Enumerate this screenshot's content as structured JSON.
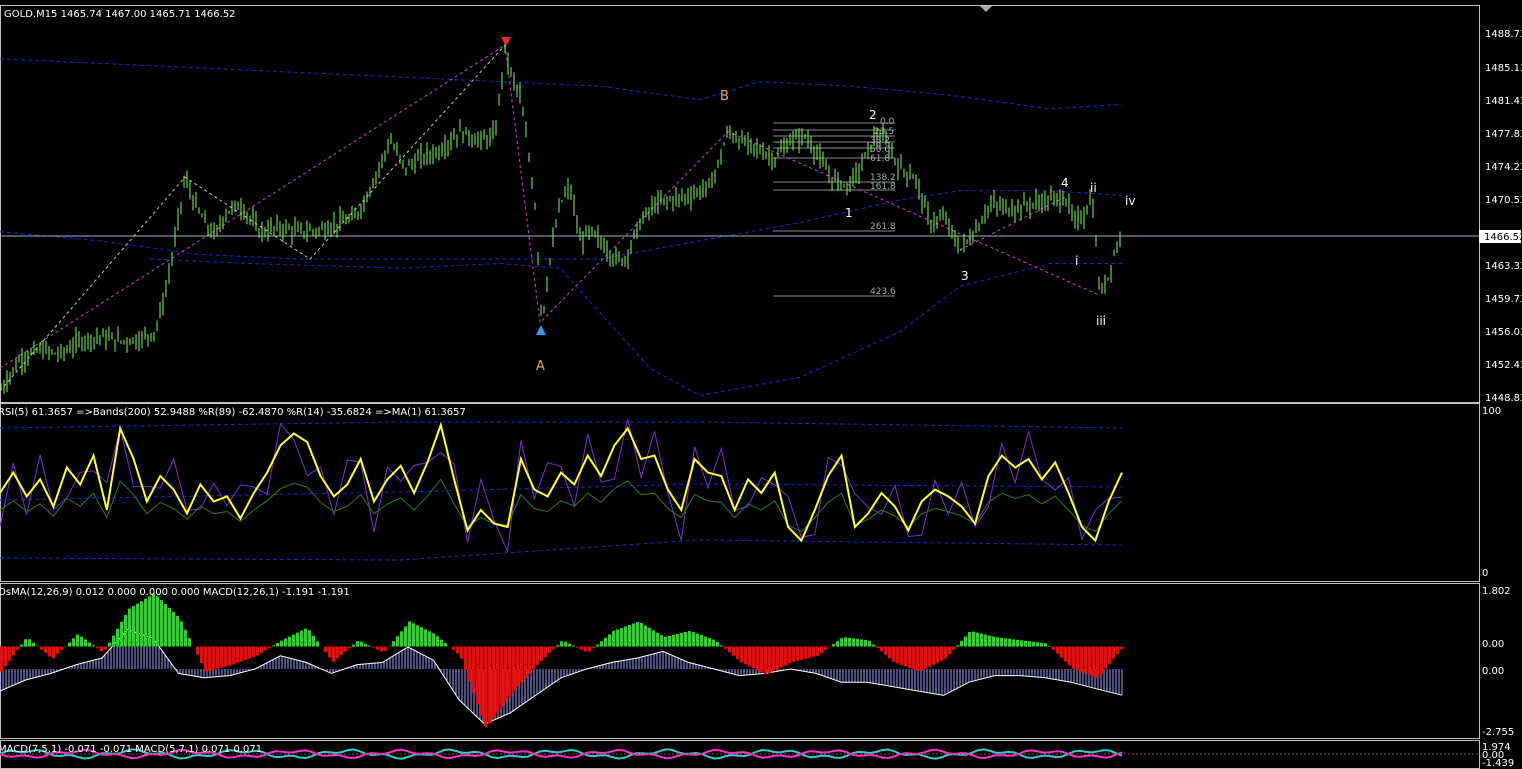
{
  "window": {
    "symbol_header": "GOLD,M15  1465.74 1467.00 1465.71 1466.52"
  },
  "colors": {
    "background": "#000000",
    "candle": "#7CFC5A",
    "band": "#2222cc",
    "rsi": "#ffff33",
    "rsi_r89": "#7a2fd0",
    "rsi_r14": "#2f7a1f",
    "hist_up": "#33cc33",
    "hist_down": "#dd1111",
    "macd_bars": "#9a9aff",
    "macd_line": "#ffffff",
    "small_macd_main": "#33cccc",
    "small_macd_signal": "#ff33cc",
    "border": "#c0c0c0"
  },
  "price_panel": {
    "current_price_label": "1466.52",
    "y_ticks": [
      "1488.73",
      "1485.13",
      "1481.43",
      "1477.83",
      "1474.23",
      "1470.53",
      "1466.52",
      "1463.33",
      "1459.73",
      "1456.03",
      "1452.43",
      "1448.83"
    ]
  },
  "wave_labels": {
    "A": "A",
    "B": "B",
    "w1": "1",
    "w2": "2",
    "w3": "3",
    "w4": "4",
    "wi": "i",
    "wii": "ii",
    "wiii": "iii",
    "wiv": "iv"
  },
  "fib_levels": [
    "0.0",
    "23.5",
    "38.2",
    "50.0",
    "61.8",
    "138.2",
    "161.8",
    "261.8",
    "423.6"
  ],
  "rsi_panel": {
    "header": "RSI(5) 61.3657  =>Bands(200) 52.9488  %R(89) -62.4870  %R(14) -35.6824  =>MA(1) 61.3657",
    "y_top": "100",
    "y_bottom": "0"
  },
  "osma_panel": {
    "header": "OsMA(12,26,9) 0.012 0.000 0.000 0.000  MACD(12,26,1) -1.191 -1.191",
    "y_top": "1.802",
    "y_mid": "0.00",
    "y_mid2": "0.00",
    "y_bottom": "-2.755"
  },
  "small_macd_panel": {
    "header": "MACD(7,5,1) -0.071 -0.071  MACD(5,7,1) 0.071 0.071",
    "y_top": "1.974",
    "y_mid": "0.00",
    "y_bottom": "-1.439"
  },
  "chart_data": {
    "type": "line",
    "title": "GOLD,M15",
    "price_path": [
      [
        0,
        1449.5
      ],
      [
        20,
        1453
      ],
      [
        40,
        1454
      ],
      [
        60,
        1453.5
      ],
      [
        80,
        1455
      ],
      [
        100,
        1455.5
      ],
      [
        120,
        1455
      ],
      [
        140,
        1455.2
      ],
      [
        155,
        1456
      ],
      [
        165,
        1460
      ],
      [
        175,
        1466
      ],
      [
        185,
        1473
      ],
      [
        195,
        1470
      ],
      [
        205,
        1468
      ],
      [
        215,
        1466.5
      ],
      [
        225,
        1469
      ],
      [
        240,
        1470
      ],
      [
        260,
        1467
      ],
      [
        280,
        1467.5
      ],
      [
        300,
        1467
      ],
      [
        320,
        1467.2
      ],
      [
        340,
        1468
      ],
      [
        355,
        1468.5
      ],
      [
        365,
        1470.5
      ],
      [
        375,
        1473
      ],
      [
        390,
        1477
      ],
      [
        405,
        1474
      ],
      [
        420,
        1475
      ],
      [
        440,
        1476
      ],
      [
        460,
        1478
      ],
      [
        480,
        1477
      ],
      [
        495,
        1477.5
      ],
      [
        505,
        1487
      ],
      [
        512,
        1484
      ],
      [
        520,
        1482
      ],
      [
        528,
        1476
      ],
      [
        535,
        1470
      ],
      [
        542,
        1457
      ],
      [
        550,
        1464
      ],
      [
        560,
        1470
      ],
      [
        570,
        1472
      ],
      [
        580,
        1466
      ],
      [
        590,
        1467
      ],
      [
        600,
        1466
      ],
      [
        615,
        1464
      ],
      [
        625,
        1464
      ],
      [
        640,
        1468
      ],
      [
        655,
        1470
      ],
      [
        670,
        1470.5
      ],
      [
        690,
        1471
      ],
      [
        710,
        1472
      ],
      [
        720,
        1475
      ],
      [
        728,
        1478
      ],
      [
        740,
        1477
      ],
      [
        760,
        1476
      ],
      [
        775,
        1475
      ],
      [
        790,
        1477
      ],
      [
        805,
        1477.5
      ],
      [
        815,
        1476
      ],
      [
        830,
        1473
      ],
      [
        848,
        1472
      ],
      [
        860,
        1474
      ],
      [
        875,
        1477.5
      ],
      [
        885,
        1477
      ],
      [
        900,
        1474
      ],
      [
        915,
        1473
      ],
      [
        930,
        1468
      ],
      [
        945,
        1468.5
      ],
      [
        960,
        1465
      ],
      [
        975,
        1467
      ],
      [
        990,
        1470
      ],
      [
        1010,
        1469.5
      ],
      [
        1030,
        1470
      ],
      [
        1050,
        1470.5
      ],
      [
        1065,
        1470.8
      ],
      [
        1075,
        1468
      ],
      [
        1085,
        1469
      ],
      [
        1092,
        1471
      ],
      [
        1100,
        1460
      ],
      [
        1108,
        1462
      ],
      [
        1115,
        1465
      ],
      [
        1122,
        1466.5
      ]
    ],
    "bands_upper": [
      [
        0,
        1486
      ],
      [
        100,
        1485.5
      ],
      [
        200,
        1485
      ],
      [
        300,
        1484.5
      ],
      [
        400,
        1484
      ],
      [
        500,
        1483.5
      ],
      [
        600,
        1483
      ],
      [
        700,
        1481.5
      ],
      [
        760,
        1483.5
      ],
      [
        850,
        1483
      ],
      [
        950,
        1482
      ],
      [
        1050,
        1480.5
      ],
      [
        1122,
        1481
      ]
    ],
    "bands_middle": [
      [
        0,
        1467
      ],
      [
        100,
        1466
      ],
      [
        200,
        1464.5
      ],
      [
        300,
        1464
      ],
      [
        400,
        1464
      ],
      [
        500,
        1464
      ],
      [
        600,
        1464
      ],
      [
        700,
        1466
      ],
      [
        800,
        1468
      ],
      [
        900,
        1470.5
      ],
      [
        960,
        1471.5
      ],
      [
        1050,
        1471.5
      ],
      [
        1122,
        1471
      ]
    ],
    "bands_lower": [
      [
        150,
        1464
      ],
      [
        250,
        1463.5
      ],
      [
        400,
        1463
      ],
      [
        500,
        1463.5
      ],
      [
        560,
        1463
      ],
      [
        650,
        1452
      ],
      [
        700,
        1449
      ],
      [
        800,
        1451
      ],
      [
        900,
        1456
      ],
      [
        960,
        1461
      ],
      [
        1050,
        1463.5
      ],
      [
        1122,
        1463.5
      ]
    ],
    "rsi": [
      50,
      62,
      48,
      58,
      42,
      65,
      55,
      72,
      40,
      88,
      70,
      45,
      60,
      52,
      38,
      55,
      45,
      48,
      35,
      50,
      62,
      78,
      85,
      80,
      60,
      48,
      55,
      70,
      45,
      58,
      66,
      50,
      68,
      90,
      58,
      28,
      40,
      32,
      30,
      70,
      52,
      48,
      62,
      55,
      72,
      60,
      78,
      88,
      70,
      72,
      52,
      40,
      70,
      62,
      60,
      40,
      58,
      50,
      62,
      30,
      22,
      40,
      60,
      72,
      30,
      38,
      50,
      42,
      28,
      45,
      52,
      48,
      42,
      32,
      60,
      72,
      65,
      70,
      58,
      68,
      50,
      30,
      22,
      45,
      62
    ],
    "osma": [
      -0.8,
      0.3,
      -0.4,
      0.4,
      -0.2,
      1.2,
      1.7,
      0.9,
      -0.8,
      -0.6,
      -0.3,
      0.2,
      0.6,
      -0.5,
      0.2,
      -0.2,
      0.8,
      0.4,
      -0.3,
      -2.6,
      -1.5,
      -0.6,
      0.2,
      -0.2,
      0.5,
      0.8,
      0.3,
      0.5,
      0.2,
      -0.5,
      -0.9,
      -0.5,
      -0.3,
      0.3,
      0.2,
      -0.5,
      -0.8,
      -0.4,
      0.5,
      0.3,
      0.2,
      0.1,
      -0.7,
      -1.0,
      0.0
    ],
    "macd_line": [
      -1.0,
      -0.5,
      -0.2,
      0.2,
      0.5,
      1.8,
      1.4,
      -0.2,
      -0.4,
      -0.3,
      0.0,
      0.6,
      0.3,
      -0.2,
      0.2,
      0.3,
      1.0,
      0.4,
      -1.4,
      -2.5,
      -2.0,
      -1.2,
      -0.4,
      0.0,
      0.3,
      0.5,
      0.8,
      0.3,
      0.0,
      -0.3,
      -0.2,
      0.0,
      -0.2,
      -0.6,
      -0.6,
      -0.8,
      -1.0,
      -1.2,
      -0.6,
      -0.3,
      -0.3,
      -0.4,
      -0.6,
      -0.9,
      -1.19
    ]
  }
}
